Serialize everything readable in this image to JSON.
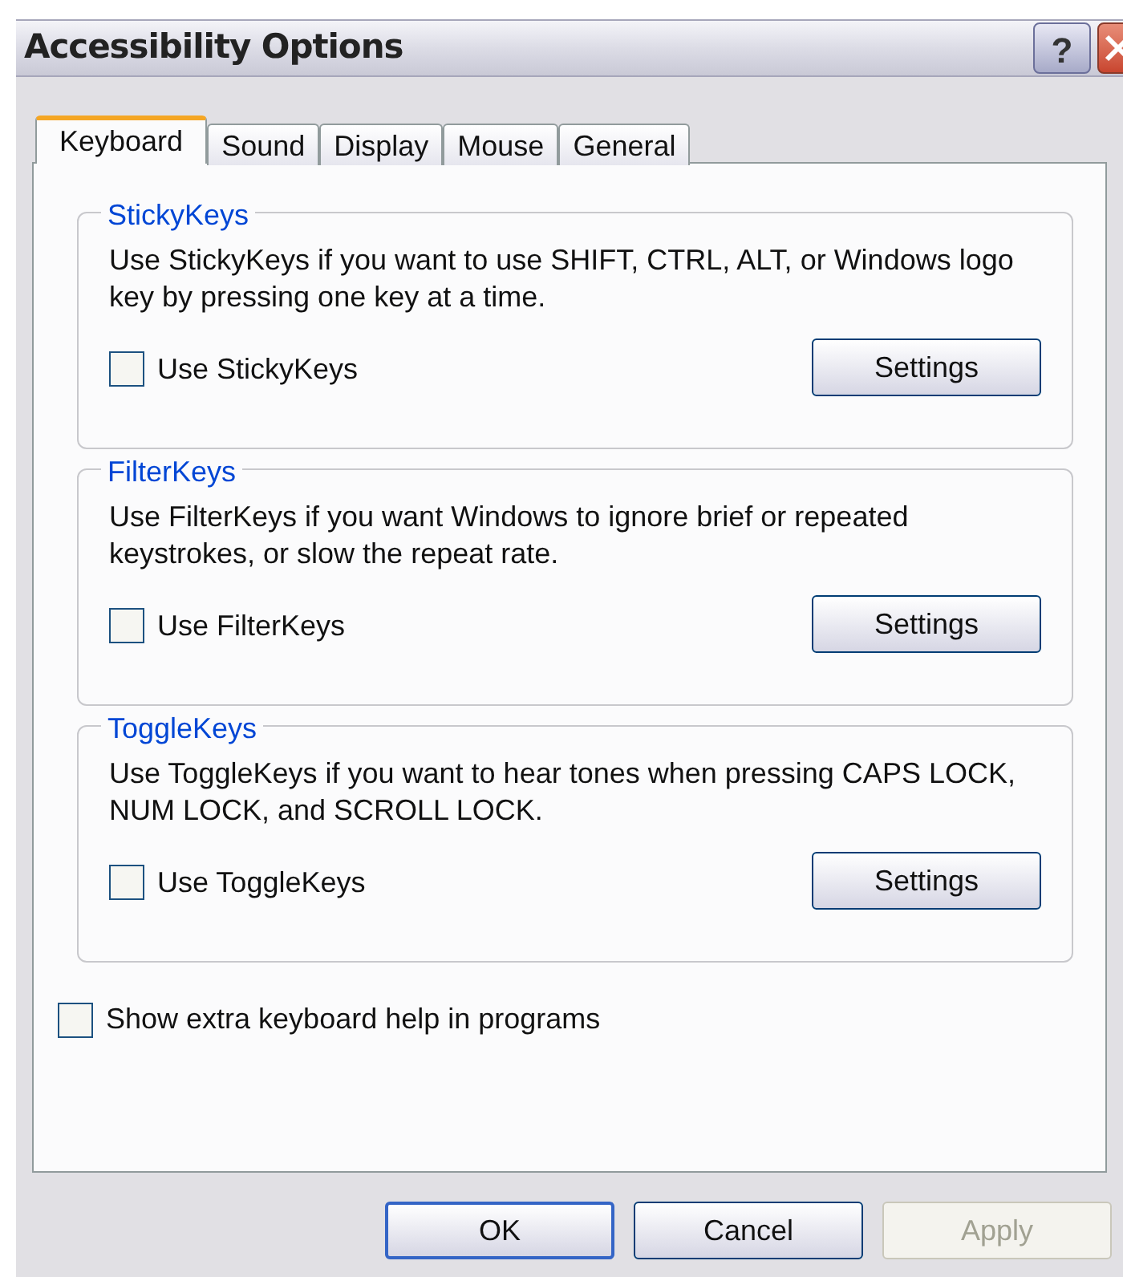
{
  "window": {
    "title": "Accessibility Options",
    "help_button": "?"
  },
  "tabs": [
    {
      "label": "Keyboard",
      "selected": true
    },
    {
      "label": "Sound",
      "selected": false
    },
    {
      "label": "Display",
      "selected": false
    },
    {
      "label": "Mouse",
      "selected": false
    },
    {
      "label": "General",
      "selected": false
    }
  ],
  "groups": [
    {
      "title": "StickyKeys",
      "description": "Use StickyKeys if you want to use SHIFT, CTRL, ALT, or Windows logo key by pressing one key at a time.",
      "checkbox": {
        "label": "Use StickyKeys",
        "checked": false
      },
      "button": "Settings"
    },
    {
      "title": "FilterKeys",
      "description": "Use FilterKeys if you want Windows to ignore brief or repeated keystrokes, or slow the repeat rate.",
      "checkbox": {
        "label": "Use FilterKeys",
        "checked": false
      },
      "button": "Settings"
    },
    {
      "title": "ToggleKeys",
      "description": "Use ToggleKeys if you want to hear tones when pressing CAPS LOCK, NUM LOCK, and SCROLL LOCK.",
      "checkbox": {
        "label": "Use ToggleKeys",
        "checked": false
      },
      "button": "Settings"
    }
  ],
  "extra_checkbox": {
    "label": "Show extra keyboard help in programs",
    "checked": false
  },
  "buttons": [
    {
      "label": "OK",
      "disabled": false,
      "default": true
    },
    {
      "label": "Cancel",
      "disabled": false,
      "default": false
    },
    {
      "label": "Apply",
      "disabled": true,
      "default": false
    }
  ]
}
